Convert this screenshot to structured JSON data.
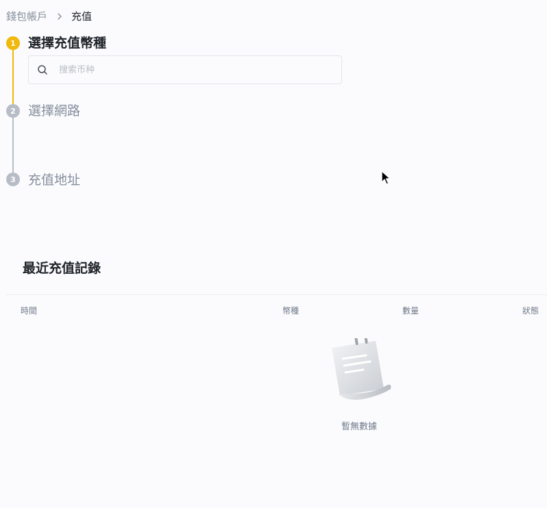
{
  "breadcrumb": {
    "parent": "錢包帳戶",
    "current": "充值"
  },
  "steps": [
    {
      "number": "1",
      "title": "選擇充值幣種",
      "state": "active"
    },
    {
      "number": "2",
      "title": "選擇網路",
      "state": "inactive"
    },
    {
      "number": "3",
      "title": "充值地址",
      "state": "inactive"
    }
  ],
  "search": {
    "placeholder": "搜索币种",
    "value": ""
  },
  "records": {
    "title": "最近充值記錄",
    "columns": [
      "時間",
      "幣種",
      "數量",
      "狀態"
    ],
    "empty_text": "暫無數據"
  },
  "icons": {
    "breadcrumb_separator": "chevron-right-icon",
    "search": "search-icon",
    "empty": "empty-document-icon",
    "cursor": "mouse-pointer-icon"
  },
  "colors": {
    "accent": "#f0b90b",
    "inactive": "#b7bdc6",
    "background": "#fbfbfd",
    "text_primary": "#1e2329",
    "text_secondary": "#848e9c"
  }
}
